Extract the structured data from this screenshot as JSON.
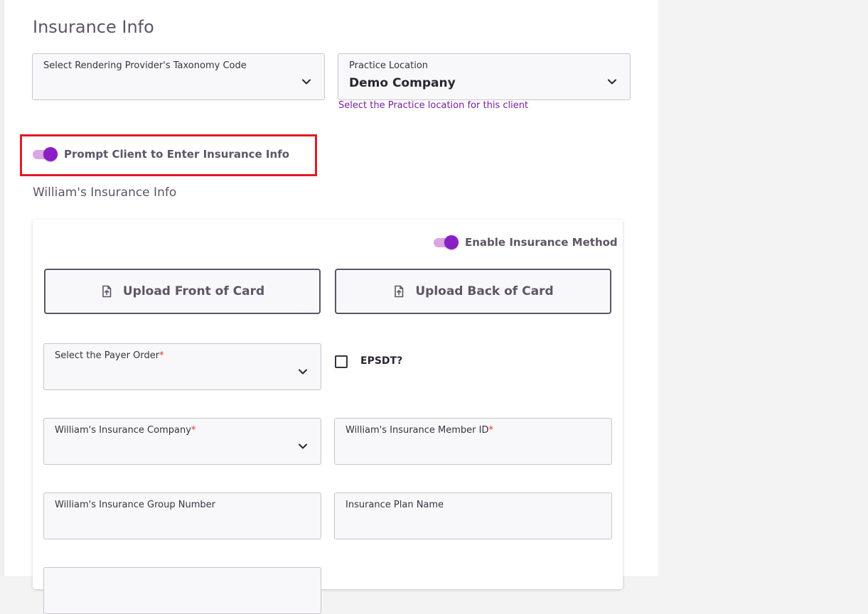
{
  "insurance_info": {
    "title": "Insurance Info",
    "taxonomy_select": {
      "label": "Select Rendering Provider's Taxonomy Code",
      "value": ""
    },
    "practice_location": {
      "label": "Practice Location",
      "value": "Demo Company",
      "helper": "Select the Practice location for this client"
    },
    "prompt_toggle": {
      "label": "Prompt Client to Enter Insurance Info",
      "checked": true
    },
    "highlight_color": "#e01b24"
  },
  "client_insurance": {
    "title": "William's Insurance Info",
    "enable_toggle": {
      "label": "Enable Insurance Method",
      "checked": true
    },
    "upload_front_label": "Upload Front of Card",
    "upload_back_label": "Upload Back of Card",
    "upload_icon": "file-upload-icon",
    "payer_order": {
      "label": "Select the Payer Order",
      "required_mark": "*",
      "value": ""
    },
    "epsdt": {
      "label": "EPSDT?",
      "checked": false
    },
    "insurance_company": {
      "label": "William's Insurance Company",
      "required_mark": "*",
      "value": ""
    },
    "member_id": {
      "label": "William's Insurance Member ID",
      "required_mark": "*",
      "value": ""
    },
    "group_number": {
      "label": "William's Insurance Group Number",
      "value": ""
    },
    "plan_name": {
      "label": "Insurance Plan Name",
      "value": ""
    }
  },
  "colors": {
    "accent": "#8b1ec4",
    "accent_light": "#d9a6e6",
    "helper_text": "#7a1fa0",
    "required": "#e0302f",
    "text_muted": "#5d5566"
  }
}
